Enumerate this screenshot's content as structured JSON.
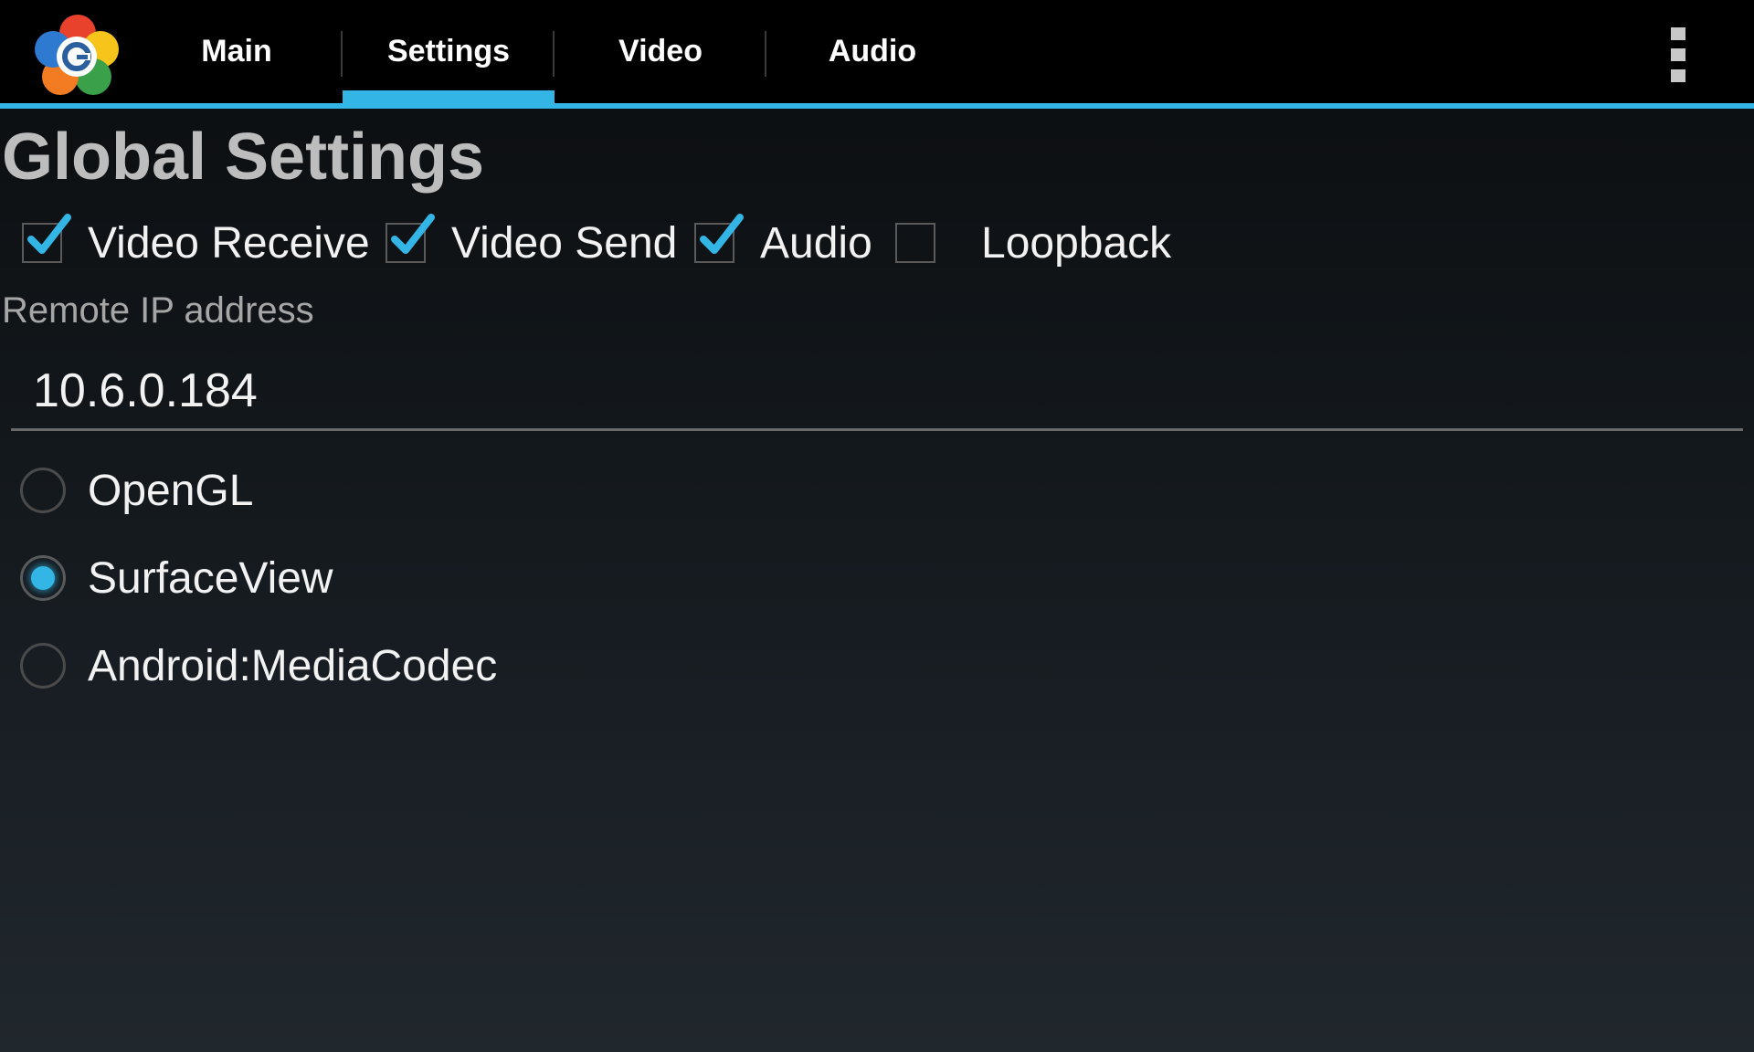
{
  "app": {
    "logo_icon": "webrtc-flower-logo-icon",
    "accent_color": "#33b5e5"
  },
  "tabs": [
    {
      "label": "Main",
      "selected": false
    },
    {
      "label": "Settings",
      "selected": true
    },
    {
      "label": "Video",
      "selected": false
    },
    {
      "label": "Audio",
      "selected": false
    }
  ],
  "overflow_menu": {
    "icon": "overflow-menu-icon"
  },
  "page": {
    "title": "Global Settings"
  },
  "checkboxes": [
    {
      "label": "Video Receive",
      "checked": true
    },
    {
      "label": "Video Send",
      "checked": true
    },
    {
      "label": "Audio",
      "checked": true
    },
    {
      "label": "Loopback",
      "checked": false
    }
  ],
  "remote_ip": {
    "label": "Remote IP address",
    "value": "10.6.0.184"
  },
  "renderers": [
    {
      "label": "OpenGL",
      "selected": false
    },
    {
      "label": "SurfaceView",
      "selected": true
    },
    {
      "label": "Android:MediaCodec",
      "selected": false
    }
  ]
}
